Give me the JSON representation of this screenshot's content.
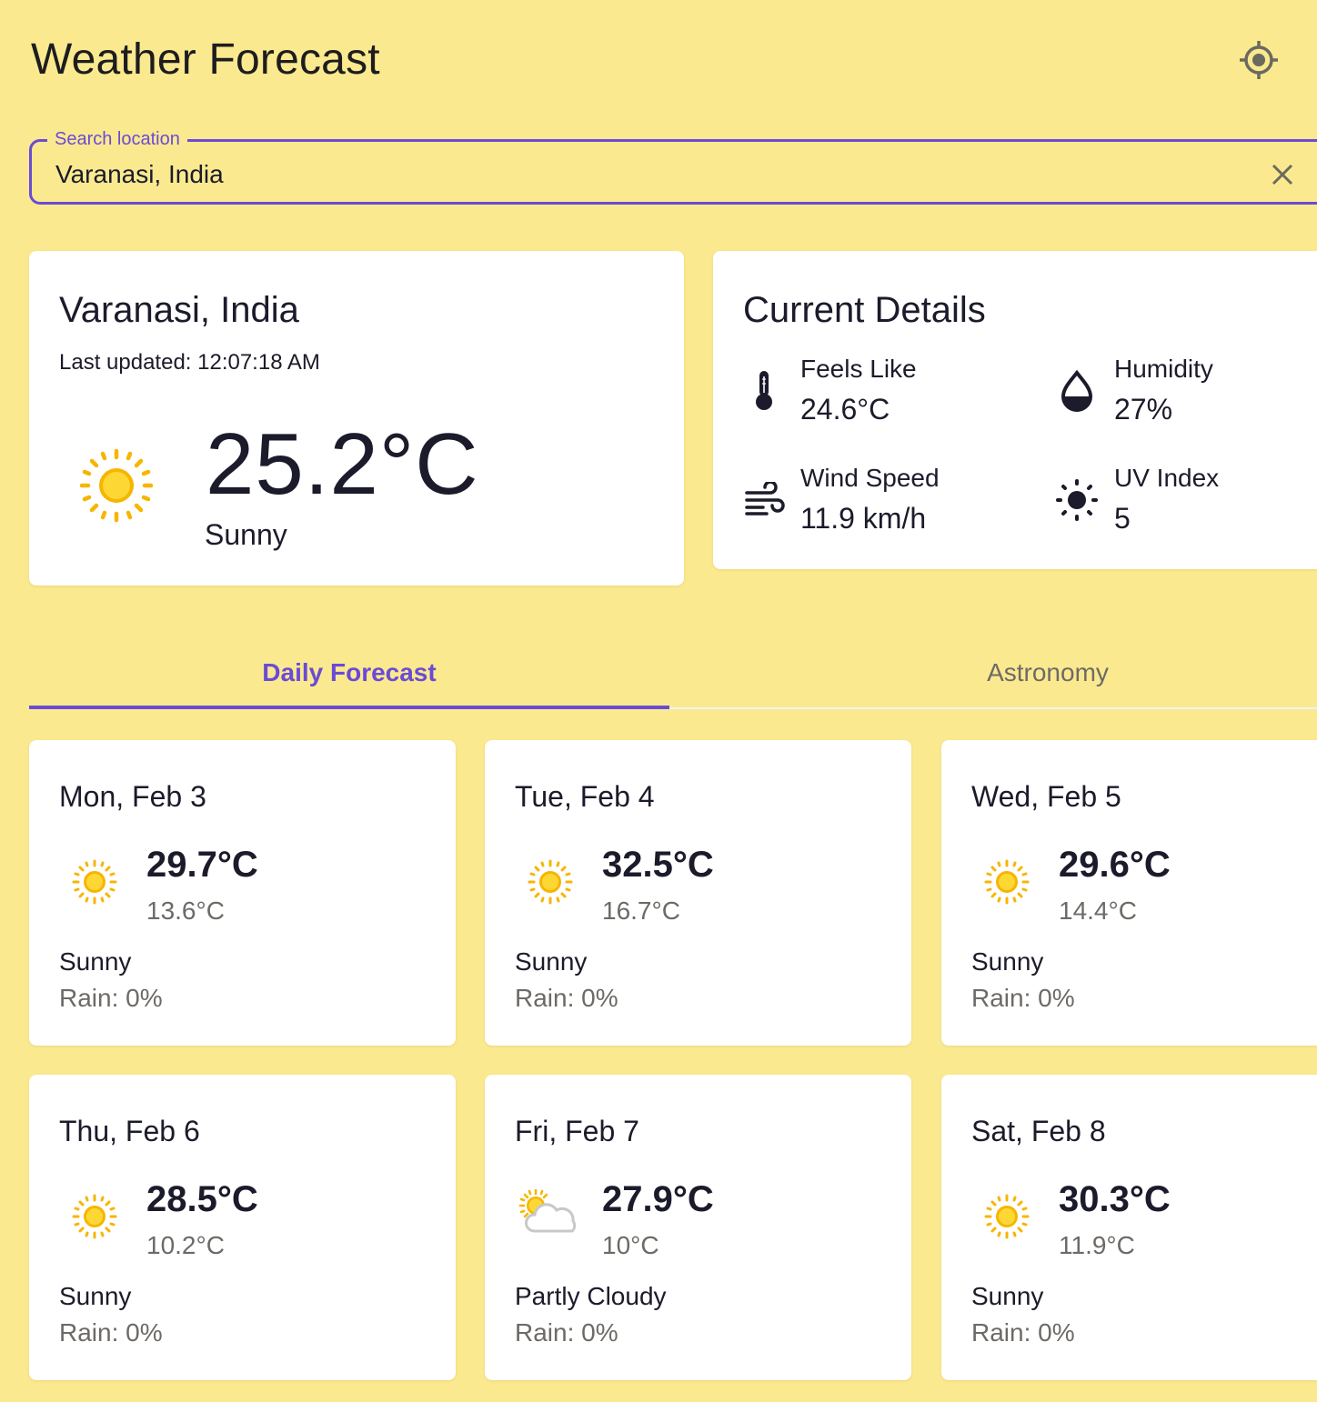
{
  "header": {
    "title": "Weather Forecast",
    "locate_icon": "crosshair-gps-icon"
  },
  "search": {
    "label": "Search location",
    "value": "Varanasi, India",
    "placeholder": "Search location",
    "clear_icon": "close-icon"
  },
  "current": {
    "location": "Varanasi, India",
    "updated_label": "Last updated:",
    "updated_time": "12:07:18 AM",
    "temperature": "25.2°C",
    "condition": "Sunny",
    "icon": "sun-icon"
  },
  "details": {
    "title": "Current Details",
    "items": [
      {
        "label": "Feels Like",
        "value": "24.6°C",
        "icon": "thermometer-icon"
      },
      {
        "label": "Humidity",
        "value": "27%",
        "icon": "water-drop-icon"
      },
      {
        "label": "Wind Speed",
        "value": "11.9 km/h",
        "icon": "wind-icon"
      },
      {
        "label": "UV Index",
        "value": "5",
        "icon": "uv-sun-icon"
      }
    ]
  },
  "tabs": [
    {
      "label": "Daily Forecast",
      "active": true
    },
    {
      "label": "Astronomy",
      "active": false
    }
  ],
  "forecast": [
    {
      "date": "Mon, Feb 3",
      "max": "29.7°C",
      "min": "13.6°C",
      "condition": "Sunny",
      "rain": "Rain: 0%",
      "icon": "sun-icon"
    },
    {
      "date": "Tue, Feb 4",
      "max": "32.5°C",
      "min": "16.7°C",
      "condition": "Sunny",
      "rain": "Rain: 0%",
      "icon": "sun-icon"
    },
    {
      "date": "Wed, Feb 5",
      "max": "29.6°C",
      "min": "14.4°C",
      "condition": "Sunny",
      "rain": "Rain: 0%",
      "icon": "sun-icon"
    },
    {
      "date": "Thu, Feb 6",
      "max": "28.5°C",
      "min": "10.2°C",
      "condition": "Sunny",
      "rain": "Rain: 0%",
      "icon": "sun-icon"
    },
    {
      "date": "Fri, Feb 7",
      "max": "27.9°C",
      "min": "10°C",
      "condition": "Partly Cloudy",
      "rain": "Rain: 0%",
      "icon": "partly-cloudy-icon"
    },
    {
      "date": "Sat, Feb 8",
      "max": "30.3°C",
      "min": "11.9°C",
      "condition": "Sunny",
      "rain": "Rain: 0%",
      "icon": "sun-icon"
    }
  ],
  "colors": {
    "background": "#fbe98f",
    "accent": "#6a4bd6",
    "card": "#ffffff",
    "muted_text": "#6d6a66",
    "sun": "#f7b500"
  }
}
